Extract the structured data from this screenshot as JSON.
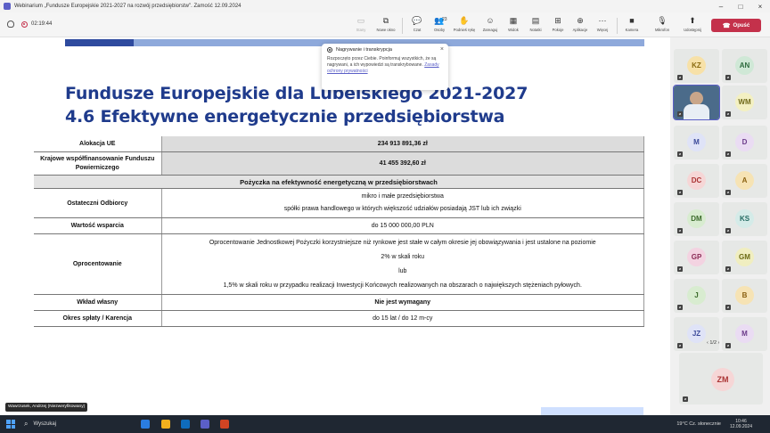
{
  "window": {
    "title": "Webinarium „Fundusze Europejskie 2021-2027 na rozwój przedsiębiorstw\". Zamość 12.09.2024"
  },
  "toolbar": {
    "timer": "02:19:44",
    "buttons": {
      "stage": "Stany",
      "new_window": "Nowe okno",
      "chat": "Czat",
      "people": "Osoby",
      "people_count": "23",
      "raise_hand": "Podnieś rękę",
      "react": "Zareaguj",
      "view": "Widok",
      "notes": "Notatki",
      "rooms": "Pokoje",
      "apps": "Aplikacje",
      "more": "Więcej",
      "camera": "Kamera",
      "mic": "Mikrofon",
      "share": "Udostępnij",
      "leave": "Opuść"
    }
  },
  "popup": {
    "title": "Nagrywanie i transkrypcja",
    "body": "Rozpoczęto przez Ciebie. Poinformuj wszystkich, że są nagrywani, a ich wypowiedzi są transkrybowane.",
    "link": "Zasady ochrony prywatności"
  },
  "slide": {
    "title_line1": "Fundusze Europejskie dla Lubelskiego 2021-2027",
    "title_line2": "4.6 Efektywne energetycznie przedsiębiorstwa",
    "rows": {
      "alokacja_label": "Alokacja UE",
      "alokacja_value": "234 913 891,36 zł",
      "krajowe_label": "Krajowe współfinansowanie Funduszu Powierniczego",
      "krajowe_value": "41 455 392,60 zł",
      "section": "Pożyczka na efektywność energetyczną w przedsiębiorstwach",
      "odbiorcy_label": "Ostateczni Odbiorcy",
      "odbiorcy_line1": "mikro i małe przedsiębiorstwa",
      "odbiorcy_line2": "spółki prawa handlowego w których większość udziałów posiadają JST lub ich związki",
      "wartosc_label": "Wartość wsparcia",
      "wartosc_value": "do 15 000 000,00 PLN",
      "oproc_label": "Oprocentowanie",
      "oproc_line1": "Oprocentowanie Jednostkowej Pożyczki korzystniejsze niż rynkowe jest stałe w całym okresie jej obowiązywania i jest ustalone na poziomie",
      "oproc_line2": "2% w skali roku",
      "oproc_line3": "lub",
      "oproc_line4": "1,5% w skali roku w przypadku realizacji Inwestycji Końcowych realizowanych  na obszarach o największych stężeniach pyłowych.",
      "wklad_label": "Wkład własny",
      "wklad_value": "Nie jest wymagany",
      "okres_label": "Okres spłaty / Karencja",
      "okres_value": "do 15 lat / do 12 m-cy"
    }
  },
  "presenter_tag": "Wawrzusek, Andrzej (Niezweryfikowany)",
  "participants": [
    {
      "initials": "KZ",
      "bg": "#f7e1a8",
      "fg": "#8a6a10"
    },
    {
      "initials": "AN",
      "bg": "#cfe8d6",
      "fg": "#2d6b3e"
    },
    {
      "initials": "WM",
      "bg": "#f3f0c2",
      "fg": "#706a1b"
    },
    {
      "initials": "M",
      "bg": "#dfe3f7",
      "fg": "#3c4a9a"
    },
    {
      "initials": "D",
      "bg": "#eadcf3",
      "fg": "#6b3b8a"
    },
    {
      "initials": "DC",
      "bg": "#f6d6d6",
      "fg": "#a33"
    },
    {
      "initials": "A",
      "bg": "#f6e3b4",
      "fg": "#8a6010"
    },
    {
      "initials": "DM",
      "bg": "#d8ecd0",
      "fg": "#3b6b2a"
    },
    {
      "initials": "KS",
      "bg": "#d4ebe8",
      "fg": "#256b63"
    },
    {
      "initials": "GP",
      "bg": "#f3d3e1",
      "fg": "#8a2a55"
    },
    {
      "initials": "GM",
      "bg": "#f0eec0",
      "fg": "#6b6a12"
    },
    {
      "initials": "J",
      "bg": "#d8ecd0",
      "fg": "#3b6b2a"
    },
    {
      "initials": "B",
      "bg": "#f6e3b4",
      "fg": "#8a6010"
    },
    {
      "initials": "JZ",
      "bg": "#dfe3f7",
      "fg": "#3c4a9a"
    },
    {
      "initials": "M",
      "bg": "#eadcf3",
      "fg": "#6b3b8a"
    },
    {
      "initials": "ZM",
      "bg": "#f6d6d6",
      "fg": "#a33"
    }
  ],
  "pager": "1/2",
  "taskbar": {
    "search": "Wyszukaj",
    "weather": "19°C  Cz. słonecznie",
    "time": "10:46",
    "date": "12.09.2024"
  }
}
